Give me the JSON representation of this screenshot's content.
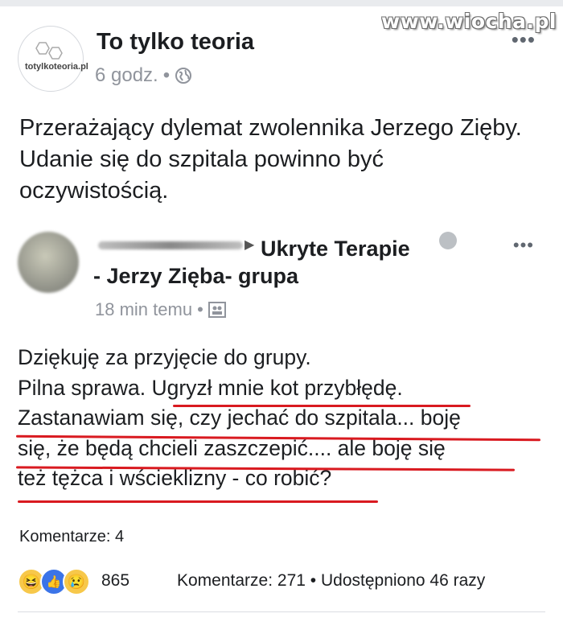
{
  "watermark": "www.wiocha.pl",
  "post": {
    "page_name": "To tylko teoria",
    "avatar_logo_text": "totylkoteoria.pl",
    "time": "6 godz.",
    "meta_dot": "•",
    "text": "Przerażający dylemat zwolennika Jerzego Zięby. Udanie się do szpitala powinno być oczywistością."
  },
  "shared": {
    "group_name_line1": "Ukryte Terapie",
    "group_name_line2": "- Jerzy Zięba- grupa",
    "time": "18 min temu",
    "meta_dot": "•",
    "line1": "Dziękuję za przyjęcie do grupy.",
    "line2a": "Pilna sprawa. ",
    "line2b": "Ugryzł mnie kot przybłędę.",
    "line3": "Zastanawiam się, czy jechać do szpitala... boję",
    "line4": "się, że będą chcieli zaszczepić.... ale boję się",
    "line5": "też tężca i wścieklizny - co robić?",
    "comments": "Komentarze: 4"
  },
  "footer": {
    "reaction_count": "865",
    "comments": "Komentarze: 271",
    "dot": "•",
    "shares": "Udostępniono 46 razy"
  },
  "icons": {
    "globe": "globe-icon",
    "group": "group-icon",
    "more": "more-icon",
    "reaction_haha": "haha-reaction-icon",
    "reaction_like": "like-reaction-icon",
    "reaction_sad": "sad-reaction-icon"
  },
  "colors": {
    "underline": "#d91a20",
    "like_blue": "#3b74e8",
    "meta_gray": "#90949c"
  }
}
